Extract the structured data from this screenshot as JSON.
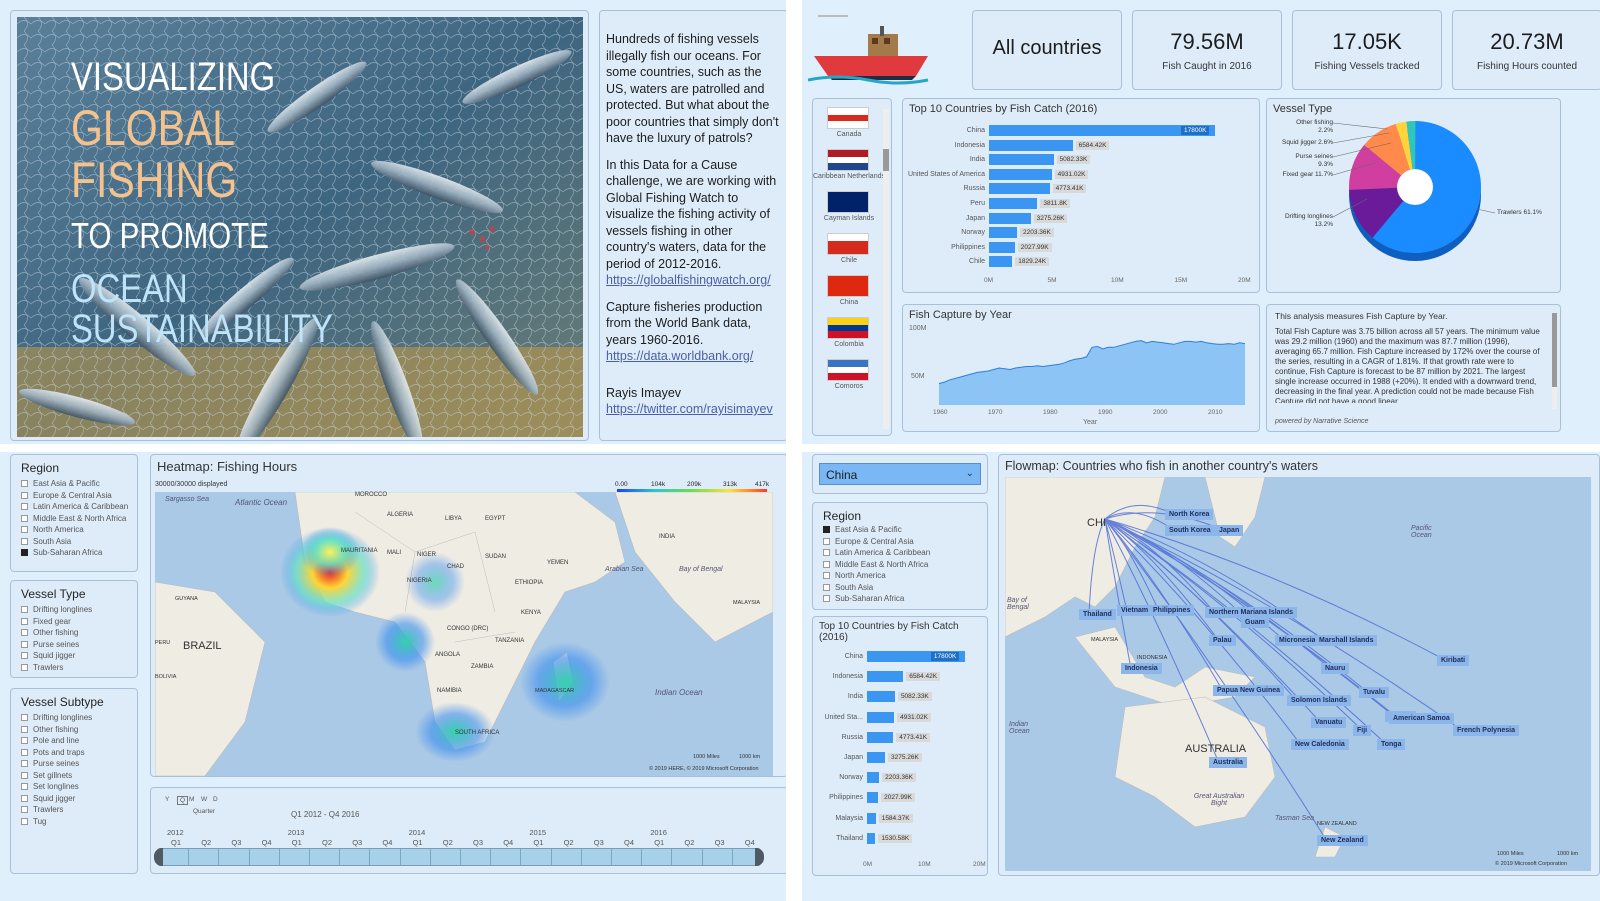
{
  "hero": {
    "line1": "VISUALIZING",
    "line2": "GLOBAL",
    "line3": "FISHING",
    "line4": "TO PROMOTE",
    "line5": "OCEAN",
    "line6": "SUSTAINABILITY"
  },
  "description": {
    "p1": "Hundreds of fishing vessels illegally fish our oceans. For some countries, such as the US, waters are patrolled and protected. But what about the poor countries that simply don't have the luxury of patrols?",
    "p2": "In this Data for a Cause challenge, we are working with Global Fishing Watch to visualize the fishing activity of vessels fishing in other country's waters, data for the period of 2012-2016.",
    "link1": "https://globalfishingwatch.org/",
    "p3": "Capture fisheries production from the World Bank data, years 1960-2016.",
    "link2": "https://data.worldbank.org/",
    "author": "Rayis Imayev",
    "link3": "https://twitter.com/rayisimayev"
  },
  "kpis": {
    "country": "All countries",
    "fish_value": "79.56M",
    "fish_label": "Fish Caught in 2016",
    "vessels_value": "17.05K",
    "vessels_label": "Fishing Vessels tracked",
    "hours_value": "20.73M",
    "hours_label": "Fishing Hours counted"
  },
  "flags": [
    "Canada",
    "Caribbean Netherlands",
    "Cayman Islands",
    "Chile",
    "China",
    "Colombia",
    "Comoros"
  ],
  "top10_main": {
    "title": "Top 10 Countries by Fish Catch (2016)",
    "rows": [
      {
        "name": "China",
        "value": 17800,
        "label": "17800K"
      },
      {
        "name": "Indonesia",
        "value": 6584.42,
        "label": "6584.42K"
      },
      {
        "name": "India",
        "value": 5082.33,
        "label": "5082.33K"
      },
      {
        "name": "United States of America",
        "value": 4931.02,
        "label": "4931.02K"
      },
      {
        "name": "Russia",
        "value": 4773.41,
        "label": "4773.41K"
      },
      {
        "name": "Peru",
        "value": 3811.8,
        "label": "3811.8K"
      },
      {
        "name": "Japan",
        "value": 3275.26,
        "label": "3275.26K"
      },
      {
        "name": "Norway",
        "value": 2203.36,
        "label": "2203.36K"
      },
      {
        "name": "Philippines",
        "value": 2027.99,
        "label": "2027.99K"
      },
      {
        "name": "Chile",
        "value": 1829.24,
        "label": "1829.24K"
      }
    ],
    "ticks": [
      "0M",
      "5M",
      "10M",
      "15M",
      "20M"
    ]
  },
  "vessel_type": {
    "title": "Vessel Type",
    "slices": [
      {
        "name": "Trawlers",
        "pct": 61.1,
        "label": "Trawlers 61.1%",
        "color": "#1a8cff"
      },
      {
        "name": "Drifting longlines",
        "pct": 13.2,
        "label_a": "Drifting longlines",
        "label_b": "13.2%",
        "color": "#6a1b9a"
      },
      {
        "name": "Fixed gear",
        "pct": 11.7,
        "label": "Fixed gear 11.7%",
        "color": "#d03fa0"
      },
      {
        "name": "Purse seines",
        "pct": 9.3,
        "label_a": "Purse seines",
        "label_b": "9.3%",
        "color": "#ff8a4c"
      },
      {
        "name": "Squid jigger",
        "pct": 2.6,
        "label": "Squid jigger 2.6%",
        "color": "#ffd33a"
      },
      {
        "name": "Other fishing",
        "pct": 2.2,
        "label_a": "Other fishing",
        "label_b": "2.2%",
        "color": "#2ec7b8"
      }
    ]
  },
  "capture_by_year": {
    "title": "Fish Capture by Year",
    "y_ticks": [
      "100M",
      "50M"
    ],
    "x_ticks": [
      "1960",
      "1970",
      "1980",
      "1990",
      "2000",
      "2010"
    ],
    "xlabel": "Year"
  },
  "narrative": {
    "p1": "This analysis measures Fish Capture by Year.",
    "p2": "Total Fish Capture was 3.75 billion across all 57 years. The minimum value was 29.2 million (1960) and the maximum was 87.7 million (1996), averaging 65.7 million. Fish Capture increased by 172% over the course of the series, resulting in a CAGR of 1.81%. If that growth rate were to continue, Fish Capture is forecast to be 87 million by 2021. The largest single increase occurred in 1988 (+20%). It ended with a downward trend, decreasing in the final year. A prediction could not be made because Fish Capture did not have a good linear",
    "footer": "powered by Narrative Science"
  },
  "region_slicer": {
    "title": "Region",
    "items": [
      "East Asia & Pacific",
      "Europe & Central Asia",
      "Latin America & Caribbean",
      "Middle East & North Africa",
      "North America",
      "South Asia",
      "Sub-Saharan Africa"
    ],
    "selected": "Sub-Saharan Africa"
  },
  "vessel_type_slicer": {
    "title": "Vessel Type",
    "items": [
      "Drifting longlines",
      "Fixed gear",
      "Other fishing",
      "Purse seines",
      "Squid jigger",
      "Trawlers"
    ]
  },
  "vessel_subtype_slicer": {
    "title": "Vessel Subtype",
    "items": [
      "Drifting longlines",
      "Other fishing",
      "Pole and line",
      "Pots and traps",
      "Purse seines",
      "Set gillnets",
      "Set longlines",
      "Squid jigger",
      "Trawlers",
      "Tug"
    ]
  },
  "heatmap": {
    "title": "Heatmap: Fishing Hours",
    "displayed": "30000/30000 displayed",
    "legend": [
      "0.00",
      "104k",
      "209k",
      "313k",
      "417k"
    ],
    "labels": {
      "sargasso": "Sargasso Sea",
      "atlantic": "Atlantic Ocean",
      "morocco": "MOROCCO",
      "algeria": "ALGERIA",
      "libya": "LIBYA",
      "egypt": "EGYPT",
      "mali": "MALI",
      "niger": "NIGER",
      "sudan": "SUDAN",
      "nigeria": "NIGERIA",
      "chad": "CHAD",
      "ethiopia": "ETHIOPIA",
      "congo": "CONGO (DRC)",
      "tanzania": "TANZANIA",
      "angola": "ANGOLA",
      "zambia": "ZAMBIA",
      "namibia": "NAMIBIA",
      "southafrica": "SOUTH AFRICA",
      "madagascar": "MADAGASCAR",
      "brazil": "BRAZIL",
      "india": "INDIA",
      "indian": "Indian Ocean",
      "arabian": "Arabian Sea",
      "bengal": "Bay of Bengal",
      "yemen": "YEMEN",
      "kenya": "KENYA",
      "mauritania": "MAURITANIA",
      "bolivia": "BOLIVIA",
      "peru": "PERU",
      "guyana": "GUYANA",
      "malaysia": "MALAYSIA",
      "copyright": "© 2019 HERE, © 2019 Microsoft Corporation",
      "scale_mi": "1000 Miles",
      "scale_km": "1000 km"
    }
  },
  "timeline": {
    "granularity": [
      "Y",
      "Q",
      "M",
      "W",
      "D"
    ],
    "selected_granularity": "Quarter",
    "range": "Q1 2012 - Q4 2016",
    "years": [
      "2012",
      "2013",
      "2014",
      "2015",
      "2016"
    ],
    "quarters": [
      "Q1",
      "Q2",
      "Q3",
      "Q4"
    ]
  },
  "country_select": {
    "value": "China"
  },
  "region_slicer2": {
    "title": "Region",
    "items": [
      "East Asia & Pacific",
      "Europe & Central Asia",
      "Latin America & Caribbean",
      "Middle East & North Africa",
      "North America",
      "South Asia",
      "Sub-Saharan Africa"
    ],
    "selected": "East Asia & Pacific"
  },
  "top10_side": {
    "title": "Top 10 Countries by Fish Catch (2016)",
    "rows": [
      {
        "name": "China",
        "value": 17800,
        "label": "17800K"
      },
      {
        "name": "Indonesia",
        "value": 6584.42,
        "label": "6584.42K"
      },
      {
        "name": "India",
        "value": 5082.33,
        "label": "5082.33K"
      },
      {
        "name": "United Sta...",
        "value": 4931.02,
        "label": "4931.02K"
      },
      {
        "name": "Russia",
        "value": 4773.41,
        "label": "4773.41K"
      },
      {
        "name": "Japan",
        "value": 3275.26,
        "label": "3275.26K"
      },
      {
        "name": "Norway",
        "value": 2203.36,
        "label": "2203.36K"
      },
      {
        "name": "Philippines",
        "value": 2027.99,
        "label": "2027.99K"
      },
      {
        "name": "Malaysia",
        "value": 1584.37,
        "label": "1584.37K"
      },
      {
        "name": "Thailand",
        "value": 1530.58,
        "label": "1530.58K"
      }
    ],
    "ticks": [
      "0M",
      "10M",
      "20M"
    ]
  },
  "flowmap": {
    "title": "Flowmap: Countries who fish in another country's waters",
    "origin": "CHI",
    "destinations": [
      "North Korea",
      "South Korea",
      "Japan",
      "Thailand",
      "Vietnam",
      "Philippines",
      "Northern Mariana Islands",
      "Guam",
      "Palau",
      "Micronesia",
      "Marshall Islands",
      "Kiribati",
      "Nauru",
      "Indonesia",
      "Papua New Guinea",
      "Tuvalu",
      "Solomon Islands",
      "Vanuatu",
      "Samoa",
      "American Samoa",
      "Fiji",
      "French Polynesia",
      "New Caledonia",
      "Tonga",
      "Australia",
      "New Zealand"
    ],
    "labels": {
      "australia": "AUSTRALIA",
      "pacific": "Pacific Ocean",
      "indian": "Indian Ocean",
      "malaysia": "MALAYSIA",
      "indonesia": "INDONESIA",
      "newzealand": "NEW ZEALAND",
      "tasman": "Tasman Sea",
      "bight": "Great Australian Bight",
      "bengal": "Bay of Bengal",
      "copyright": "© 2019 Microsoft Corporation",
      "scale_mi": "1000 Miles",
      "scale_km": "1000 km"
    }
  }
}
